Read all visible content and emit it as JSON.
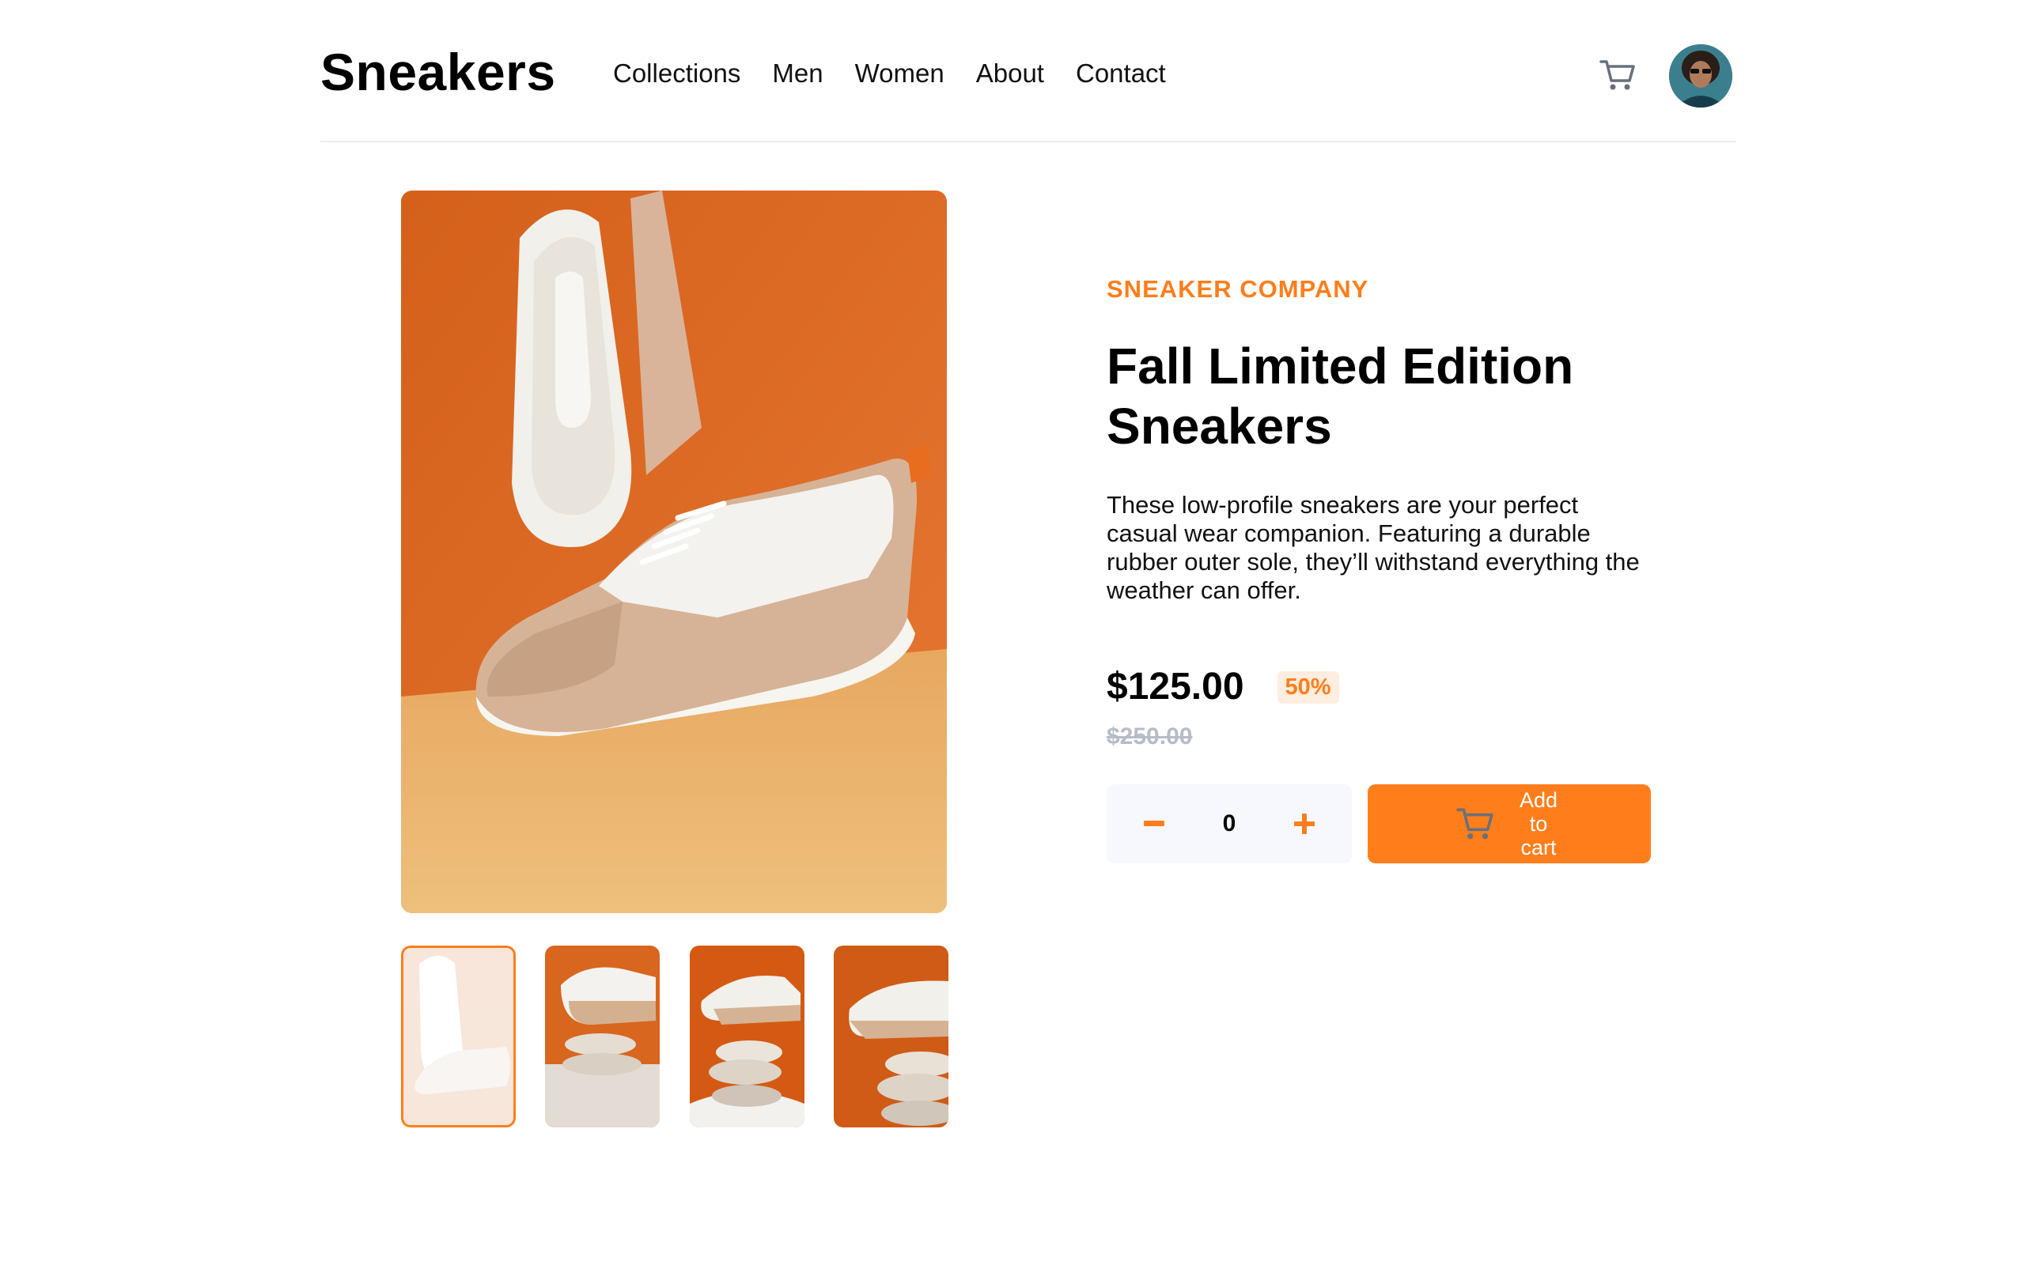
{
  "header": {
    "logo": "Sneakers",
    "nav": [
      "Collections",
      "Men",
      "Women",
      "About",
      "Contact"
    ]
  },
  "product": {
    "company": "SNEAKER COMPANY",
    "title": "Fall Limited Edition Sneakers",
    "description": "These low-profile sneakers are your perfect casual wear companion. Featuring a durable rubber outer sole, they’ll withstand everything the weather can offer.",
    "price": "$125.00",
    "discount": "50%",
    "original_price": "$250.00",
    "quantity": "0",
    "add_to_cart_label": "Add to cart"
  },
  "gallery": {
    "selected_index": 0,
    "thumbnail_count": 4
  },
  "colors": {
    "accent": "#ff7e1b",
    "accent_light": "#ffede0",
    "muted": "#b6bcc8",
    "qty_bg": "#f6f8fd"
  }
}
